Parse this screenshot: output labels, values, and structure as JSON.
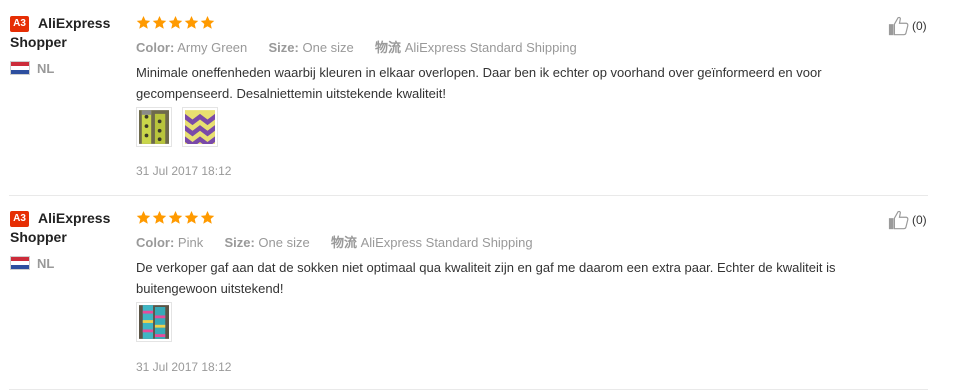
{
  "reviews": [
    {
      "user_level": "A3",
      "user_name": "AliExpress Shopper",
      "country": "NL",
      "rating": 5,
      "color_label": "Color:",
      "color_value": "Army Green",
      "size_label": "Size:",
      "size_value": "One size",
      "shipping_label": "物流",
      "shipping_value": "AliExpress Standard Shipping",
      "text": "Minimale oneffenheden waarbij kleuren in elkaar overlopen. Daar ben ik echter op voorhand over geïnformeerd en voor gecompenseerd. Desalniettemin uitstekende kwaliteit!",
      "date": "31 Jul 2017 18:12",
      "helpful_count": "(0)",
      "photos": [
        "socks-photo-green-dots",
        "socks-photo-purple-chevron"
      ]
    },
    {
      "user_level": "A3",
      "user_name": "AliExpress Shopper",
      "country": "NL",
      "rating": 5,
      "color_label": "Color:",
      "color_value": "Pink",
      "size_label": "Size:",
      "size_value": "One size",
      "shipping_label": "物流",
      "shipping_value": "AliExpress Standard Shipping",
      "text": "De verkoper gaf aan dat de sokken niet optimaal qua kwaliteit zijn en gaf me daarom een extra paar. Echter de kwaliteit is buitengewoon uitstekend!",
      "date": "31 Jul 2017 18:12",
      "helpful_count": "(0)",
      "photos": [
        "socks-photo-teal-pink"
      ]
    }
  ],
  "colors": {
    "badge": "#e62e04",
    "star": "#ff9a00",
    "muted": "#999999",
    "text": "#333333"
  },
  "icons": {
    "star": "star-icon",
    "helpful": "thumbs-up-icon",
    "flag": "netherlands-flag-icon"
  }
}
